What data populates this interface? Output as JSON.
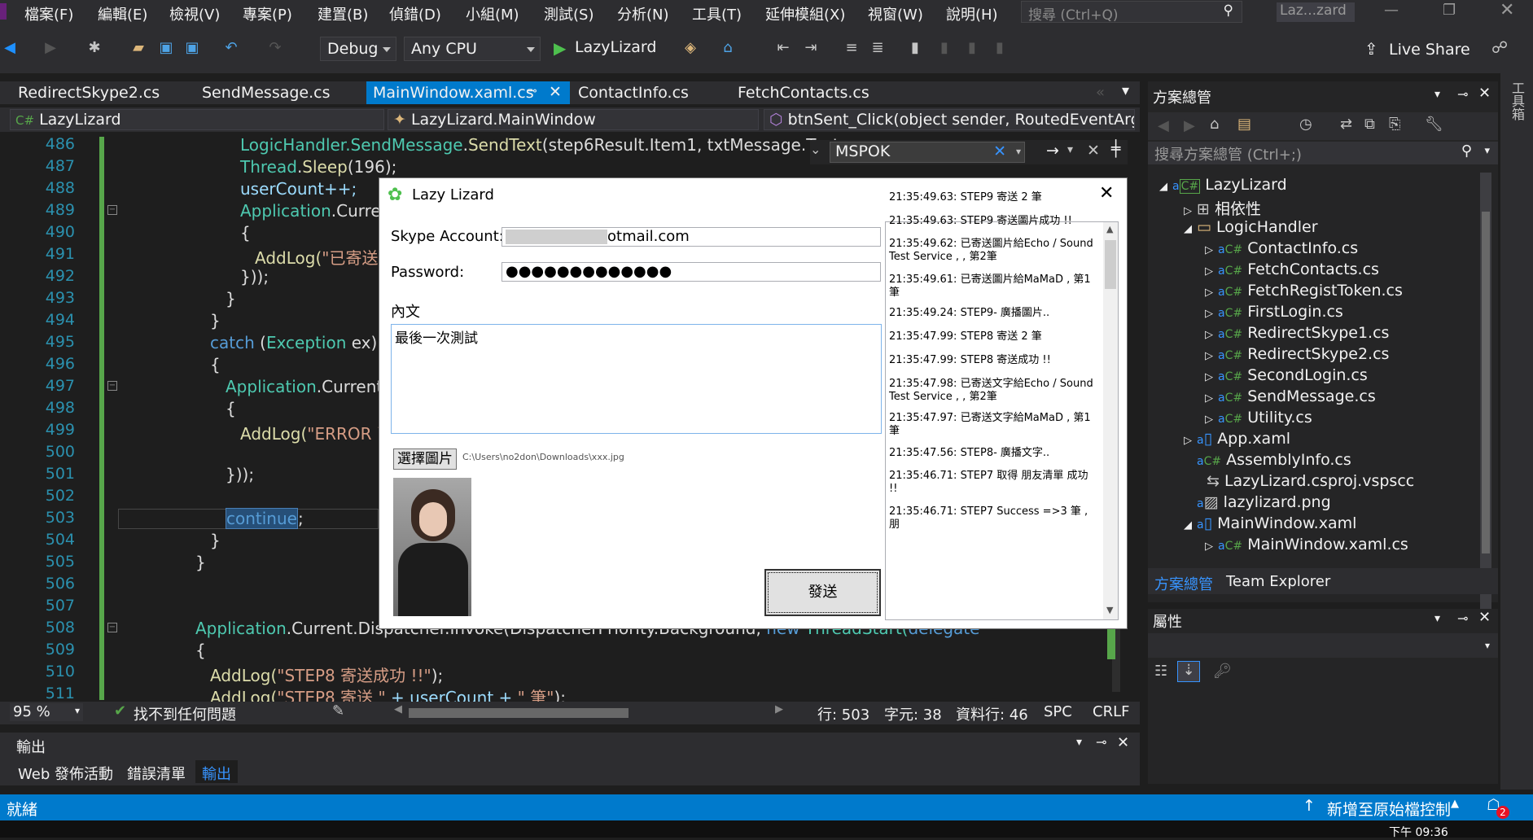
{
  "menu": [
    "檔案(F)",
    "編輯(E)",
    "檢視(V)",
    "專案(P)",
    "建置(B)",
    "偵錯(D)",
    "小組(M)",
    "測試(S)",
    "分析(N)",
    "工具(T)",
    "延伸模組(X)",
    "視窗(W)",
    "說明(H)"
  ],
  "search_placeholder": "搜尋 (Ctrl+Q)",
  "window_title": "Laz...zard",
  "toolbar": {
    "config": "Debug",
    "platform": "Any CPU",
    "run_label": "LazyLizard",
    "live_share": "Live Share"
  },
  "tabs": [
    "RedirectSkype2.cs",
    "SendMessage.cs",
    "MainWindow.xaml.cs",
    "ContactInfo.cs",
    "FetchContacts.cs"
  ],
  "active_tab": "MainWindow.xaml.cs",
  "nav": {
    "project": "LazyLizard",
    "class": "LazyLizard.MainWindow",
    "member": "btnSent_Click(object sender, RoutedEventArgs e"
  },
  "find": {
    "value": "MSPOK"
  },
  "line_numbers": [
    "486",
    "487",
    "488",
    "489",
    "490",
    "491",
    "492",
    "493",
    "494",
    "495",
    "496",
    "497",
    "498",
    "499",
    "500",
    "501",
    "502",
    "503",
    "504",
    "505",
    "506",
    "507",
    "508",
    "509",
    "510",
    "511"
  ],
  "code": {
    "l486a": "LogicHandler.",
    "l486b": "SendMessage",
    "l486c": ".",
    "l486d": "SendText",
    "l486e": "(step6Result.Item1, txtMessage.Text, c.p",
    "l487a": "Thread",
    "l487b": ".",
    "l487c": "Sleep",
    "l487d": "(196);",
    "l488": "userCount++;",
    "l489a": "Application",
    "l489b": ".Current",
    "l490": "{",
    "l491a": "AddLog(",
    "l491b": "\"已寄送文",
    "l492": "}));",
    "l493": "}",
    "l494": "}",
    "l495a": "catch",
    "l495b": " (",
    "l495c": "Exception",
    "l495d": " ex)",
    "l496": "{",
    "l497a": "Application",
    "l497b": ".Current.D",
    "l498": "{",
    "l499a": "AddLog(",
    "l499b": "\"ERROR 已",
    "l501": "}));",
    "l503a": "continue",
    "l503b": ";",
    "l504": "}",
    "l505": "}",
    "l508a": "Application",
    "l508b": ".Current.Dispatcher.Invoke(DispatcherPriority.Background, ",
    "l508c": "new",
    "l508d": " ThreadStart(",
    "l508e": "delegate",
    "l509": "{",
    "l510a": "AddLog(",
    "l510b": "\"STEP8 寄送成功 !!\"",
    "l510c": ");",
    "l511a": "AddLog(",
    "l511b": "\"STEP8 寄送 \"",
    "l511c": " + userCount + ",
    "l511d": "\" 筆\"",
    "l511e": ");"
  },
  "status": {
    "zoom": "95 %",
    "issues": "找不到任何問題",
    "line": "行: 503",
    "char": "字元: 38",
    "col": "資料行: 46",
    "spc": "SPC",
    "crlf": "CRLF"
  },
  "output": {
    "title": "輸出",
    "tabs": [
      "Web 發佈活動",
      "錯誤清單",
      "輸出"
    ]
  },
  "statusbar": {
    "ready": "就緒",
    "source_control": "新增至原始檔控制",
    "notif_count": "2",
    "clock": "下午 09:36"
  },
  "solution": {
    "title": "方案總管",
    "search": "搜尋方案總管 (Ctrl+;)",
    "items": [
      "LazyLizard",
      "相依性",
      "LogicHandler",
      "ContactInfo.cs",
      "FetchContacts.cs",
      "FetchRegistToken.cs",
      "FirstLogin.cs",
      "RedirectSkype1.cs",
      "RedirectSkype2.cs",
      "SecondLogin.cs",
      "SendMessage.cs",
      "Utility.cs",
      "App.xaml",
      "AssemblyInfo.cs",
      "LazyLizard.csproj.vspscc",
      "lazylizard.png",
      "MainWindow.xaml",
      "MainWindow.xaml.cs"
    ],
    "tab1": "方案總管",
    "tab2": "Team Explorer"
  },
  "properties": {
    "title": "屬性"
  },
  "side_strip": "工具箱",
  "dialog": {
    "title": "Lazy Lizard",
    "account_label": "Skype Account:",
    "account_value": "otmail.com",
    "password_label": "Password:",
    "password_value": "●●●●●●●●●●●●●",
    "message_label": "內文",
    "message_value": "最後一次測試",
    "choose_image": "選擇圖片",
    "image_path": "C:\\Users\\no2don\\Downloads\\xxx.jpg",
    "send": "發送",
    "log": [
      "21:35:49.63: STEP9 寄送 2 筆",
      "21:35:49.63: STEP9 寄送圖片成功 !!",
      "21:35:49.62: 已寄送圖片給Echo / Sound Test Service , , 第2筆",
      "21:35:49.61: 已寄送圖片給MaMaD , 第1筆",
      "21:35:49.24: STEP9- 廣播圖片..",
      "21:35:47.99: STEP8 寄送 2 筆",
      "21:35:47.99: STEP8 寄送成功 !!",
      "21:35:47.98: 已寄送文字給Echo / Sound Test Service , , 第2筆",
      "21:35:47.97: 已寄送文字給MaMaD , 第1筆",
      "21:35:47.56: STEP8- 廣播文字..",
      "21:35:46.71: STEP7 取得 朋友清單 成功 !!",
      "21:35:46.71: STEP7 Success =>3 筆 , 朋"
    ]
  }
}
